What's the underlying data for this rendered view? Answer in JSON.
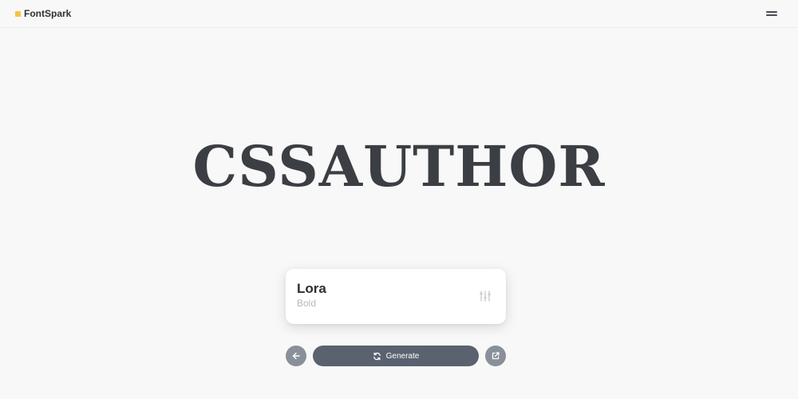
{
  "header": {
    "brand": "FontSpark",
    "brand_color": "#f5c441",
    "brand_icon": "square-logo-icon",
    "menu_icon": "hamburger-menu-icon"
  },
  "preview": {
    "text": "CSSAUTHOR"
  },
  "font_card": {
    "name": "Lora",
    "style": "Bold",
    "settings_icon": "sliders-icon"
  },
  "controls": {
    "back_icon": "arrow-left-icon",
    "generate_label": "Generate",
    "generate_icon": "refresh-icon",
    "share_icon": "external-link-icon"
  }
}
